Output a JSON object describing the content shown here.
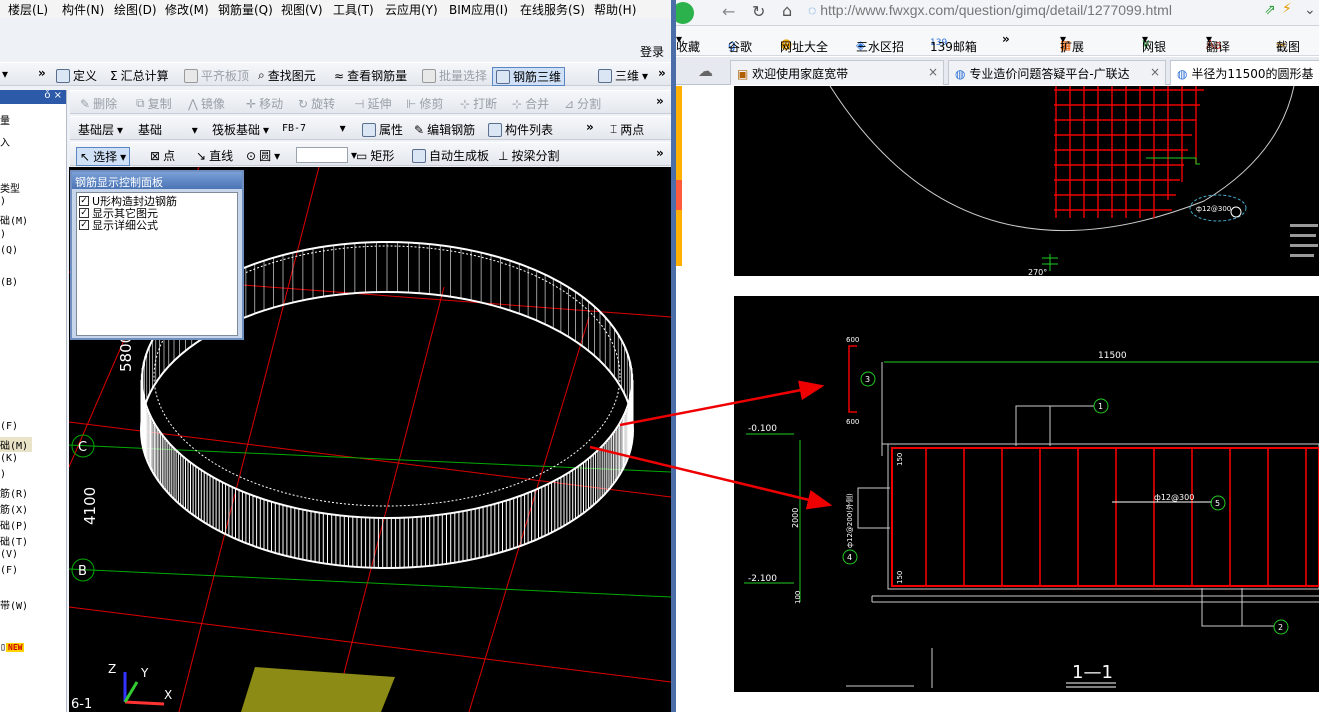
{
  "cad": {
    "menu": [
      "楼层(L)",
      "构件(N)",
      "绘图(D)",
      "修改(M)",
      "钢筋量(Q)",
      "视图(V)",
      "工具(T)",
      "云应用(Y)",
      "BIM应用(I)",
      "在线服务(S)",
      "帮助(H)"
    ],
    "login": "登录",
    "toolbar1": {
      "define": "定义",
      "sum": "汇总计算",
      "flat_top": "平齐板顶",
      "find": "查找图元",
      "view_rebar": "查看钢筋量",
      "batch": "批量选择",
      "rebar3d": "钢筋三维",
      "view3d": "三维"
    },
    "toolbar2": [
      "删除",
      "复制",
      "镜像",
      "移动",
      "旋转",
      "延伸",
      "修剪",
      "打断",
      "合并",
      "分割"
    ],
    "toolbar3": {
      "layer": "基础层",
      "type": "基础",
      "sub": "筏板基础",
      "code": "FB-7",
      "props": "属性",
      "edit_rebar": "编辑钢筋",
      "list": "构件列表",
      "twopoint": "两点"
    },
    "toolbar4": {
      "select": "选择",
      "point": "点",
      "line": "直线",
      "circle": "圆",
      "rect": "矩形",
      "auto": "自动生成板",
      "split": "按梁分割"
    },
    "left_panel": {
      "header": "ǒ ×",
      "rows": [
        "量",
        "入",
        "类型",
        ")",
        "础(M)",
        ")",
        "(Q)",
        "(B)",
        "(F)",
        "础(M)",
        "(K)",
        ")",
        "筋(R)",
        "筋(X)",
        "础(P)",
        "础(T)",
        "(V)",
        "(F)",
        "带(W)"
      ],
      "new_badge": "NEW"
    },
    "control_panel": {
      "title": "钢筋显示控制面板",
      "items": [
        "U形构造封边钢筋",
        "显示其它图元",
        "显示详细公式"
      ]
    },
    "viewport": {
      "dim_5800": "5800",
      "dim_4100": "4100",
      "axis_c": "C",
      "axis_b": "B",
      "axis_61": "6-1",
      "axis_z": "Z",
      "axis_y": "Y",
      "axis_x": "X"
    }
  },
  "browser": {
    "url": "http://www.fwxgx.com/question/gimq/detail/1277099.html",
    "bookmarks": [
      "收藏",
      "谷歌",
      "网址大全",
      "三水区招",
      "139邮箱",
      "扩展",
      "网银",
      "翻译",
      "截图"
    ],
    "tabs": [
      "欢迎使用家庭宽带",
      "专业造价问题答疑平台-广联达",
      "半径为11500的圆形基"
    ],
    "drawing1": {
      "label_angle": "270°",
      "rebar": "ф12@300"
    },
    "drawing2": {
      "dim_11500": "11500",
      "dim_600_top": "600",
      "dim_600_bot": "600",
      "elev_top": "-0.100",
      "elev_bot": "-2.100",
      "height": "2000",
      "d150a": "150",
      "d150b": "150",
      "d100": "100",
      "rebar_mid": "ф12@300",
      "rebar_side": "ф12@200(外侧)",
      "circle1": "1",
      "circle2": "2",
      "circle3": "3",
      "circle4": "4",
      "circle5": "5",
      "section": "1—1"
    }
  }
}
